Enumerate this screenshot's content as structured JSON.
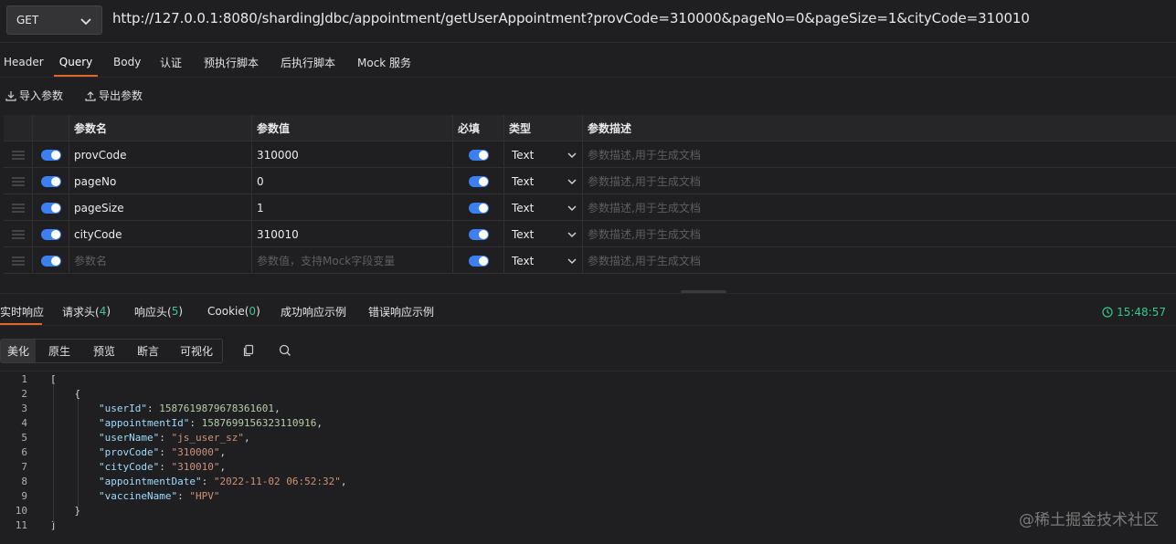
{
  "request": {
    "method": "GET",
    "url": "http://127.0.0.1:8080/shardingJdbc/appointment/getUserAppointment?provCode=310000&pageNo=0&pageSize=1&cityCode=310010"
  },
  "tabs": [
    "Header",
    "Query",
    "Body",
    "认证",
    "预执行脚本",
    "后执行脚本",
    "Mock 服务"
  ],
  "tools": {
    "import_label": "导入参数",
    "export_label": "导出参数"
  },
  "params": {
    "headers": {
      "name": "参数名",
      "value": "参数值",
      "required": "必填",
      "type": "类型",
      "desc": "参数描述"
    },
    "rows": [
      {
        "name": "provCode",
        "value": "310000",
        "type": "Text"
      },
      {
        "name": "pageNo",
        "value": "0",
        "type": "Text"
      },
      {
        "name": "pageSize",
        "value": "1",
        "type": "Text"
      },
      {
        "name": "cityCode",
        "value": "310010",
        "type": "Text"
      }
    ],
    "desc_placeholder": "参数描述,用于生成文档",
    "new_row": {
      "name_placeholder": "参数名",
      "value_placeholder": "参数值，支持Mock字段变量",
      "type": "Text"
    }
  },
  "response": {
    "tabs": {
      "realtime": "实时响应",
      "req_headers": "请求头(",
      "req_headers_count": "4",
      "resp_headers": "响应头(",
      "resp_headers_count": "5",
      "cookie": "Cookie(",
      "cookie_count": "0",
      "close": ")",
      "success_example": "成功响应示例",
      "error_example": "错误响应示例"
    },
    "time": "15:48:57",
    "modes": [
      "美化",
      "原生",
      "预览",
      "断言",
      "可视化"
    ],
    "lines": [
      {
        "n": "1",
        "parts": [
          [
            "p",
            "["
          ]
        ]
      },
      {
        "n": "2",
        "parts": [
          [
            "p",
            "    {"
          ]
        ]
      },
      {
        "n": "3",
        "parts": [
          [
            "p",
            "        "
          ],
          [
            "k",
            "\"userId\""
          ],
          [
            "p",
            ": "
          ],
          [
            "n",
            "1587619879678361601"
          ],
          [
            "p",
            ","
          ]
        ]
      },
      {
        "n": "4",
        "parts": [
          [
            "p",
            "        "
          ],
          [
            "k",
            "\"appointmentId\""
          ],
          [
            "p",
            ": "
          ],
          [
            "n",
            "1587699156323110916"
          ],
          [
            "p",
            ","
          ]
        ]
      },
      {
        "n": "5",
        "parts": [
          [
            "p",
            "        "
          ],
          [
            "k",
            "\"userName\""
          ],
          [
            "p",
            ": "
          ],
          [
            "s",
            "\"js_user_sz\""
          ],
          [
            "p",
            ","
          ]
        ]
      },
      {
        "n": "6",
        "parts": [
          [
            "p",
            "        "
          ],
          [
            "k",
            "\"provCode\""
          ],
          [
            "p",
            ": "
          ],
          [
            "s",
            "\"310000\""
          ],
          [
            "p",
            ","
          ]
        ]
      },
      {
        "n": "7",
        "parts": [
          [
            "p",
            "        "
          ],
          [
            "k",
            "\"cityCode\""
          ],
          [
            "p",
            ": "
          ],
          [
            "s",
            "\"310010\""
          ],
          [
            "p",
            ","
          ]
        ]
      },
      {
        "n": "8",
        "parts": [
          [
            "p",
            "        "
          ],
          [
            "k",
            "\"appointmentDate\""
          ],
          [
            "p",
            ": "
          ],
          [
            "s",
            "\"2022-11-02 06:52:32\""
          ],
          [
            "p",
            ","
          ]
        ]
      },
      {
        "n": "9",
        "parts": [
          [
            "p",
            "        "
          ],
          [
            "k",
            "\"vaccineName\""
          ],
          [
            "p",
            ": "
          ],
          [
            "s",
            "\"HPV\""
          ]
        ]
      },
      {
        "n": "10",
        "parts": [
          [
            "p",
            "    }"
          ]
        ]
      },
      {
        "n": "11",
        "parts": [
          [
            "p",
            "]"
          ]
        ]
      }
    ]
  },
  "watermark": "@稀土掘金技术社区",
  "colors": {
    "accent": "#e0662a",
    "toggle": "#3b7ff0",
    "success": "#35c98d"
  }
}
